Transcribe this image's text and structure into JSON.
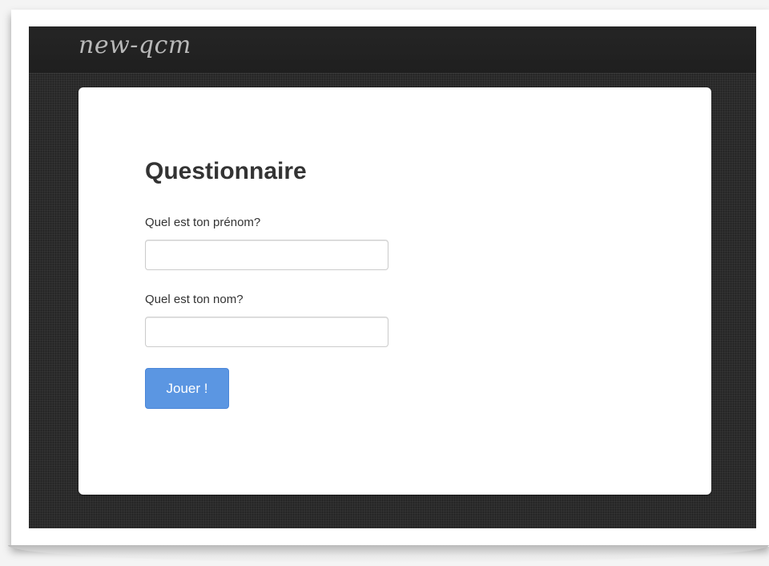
{
  "navbar": {
    "brand": "new-qcm"
  },
  "form": {
    "title": "Questionnaire",
    "first_name_label": "Quel est ton prénom?",
    "first_name_value": "",
    "last_name_label": "Quel est ton nom?",
    "last_name_value": "",
    "submit_label": "Jouer !"
  },
  "colors": {
    "navbar_bg": "#222222",
    "page_bg": "#2c2c2c",
    "card_bg": "#ffffff",
    "button_primary": "#5b96e2",
    "title_text": "#333333"
  }
}
